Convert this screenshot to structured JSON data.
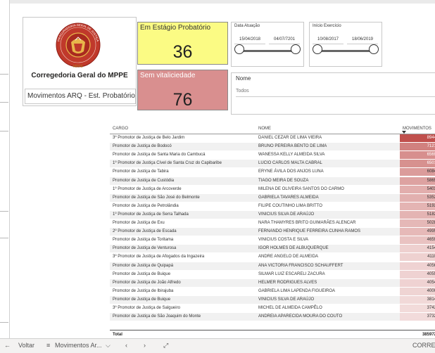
{
  "org": {
    "name": "Corregedoria Geral do MPPE",
    "report_name": "Movimentos ARQ - Est. Probatório"
  },
  "seal": {
    "text": "PROCURADORIA GERAL DE JUSTIÇA",
    "bottom": "MPPE"
  },
  "kpis": {
    "estagio": {
      "label": "Em Estágio Probatório",
      "value": "36",
      "color": "#fbfb84"
    },
    "vitaliciedade": {
      "label": "Sem vitaliciedade",
      "value": "76",
      "color": "#d98f8f"
    }
  },
  "slicers": {
    "data_atuacao": {
      "title": "Data Atuação",
      "start": "15/04/2018",
      "end": "04/07/7201"
    },
    "inicio_exercicio": {
      "title": "Início Exercício",
      "start": "10/08/2017",
      "end": "18/06/2019"
    },
    "nome": {
      "title": "Nome",
      "value": "Todos"
    }
  },
  "table": {
    "headers": {
      "cargo": "CARGO",
      "nome": "NOME",
      "movimentos": "MOVIMENTOS"
    },
    "max_movimentos": 8944,
    "colors": {
      "high": "#c0504d",
      "low": "#f4e1e1"
    },
    "rows": [
      {
        "cargo": "3º Promotor de Justiça de Belo Jardim",
        "nome": "DANIEL CEZAR DE LIMA VIEIRA",
        "movimentos": "8944"
      },
      {
        "cargo": "Promotor de Justiça de Bodocó",
        "nome": "BRUNO PEREIRA BENTO DE LIMA",
        "movimentos": "7121"
      },
      {
        "cargo": "Promotor de Justiça de Santa Maria do Cambucá",
        "nome": "WANESSA KELLY ALMEIDA SILVA",
        "movimentos": "6569"
      },
      {
        "cargo": "1º Promotor de Justiça Cível de Santa Cruz do Capibaribe",
        "nome": "LUCIO CARLOS MALTA CABRAL",
        "movimentos": "6501"
      },
      {
        "cargo": "Promotor de Justiça de Tabira",
        "nome": "ERYNE ÁVILA DOS ANJOS LUNA",
        "movimentos": "6084"
      },
      {
        "cargo": "Promotor de Justiça de Custódia",
        "nome": "TIAGO MEIRA DE SOUZA",
        "movimentos": "5865"
      },
      {
        "cargo": "1º Promotor de Justiça de Arcoverde",
        "nome": "MILENA DE OLIVEIRA SANTOS DO CARMO",
        "movimentos": "5403"
      },
      {
        "cargo": "Promotor de Justiça de São José do Belmonte",
        "nome": "GABRIELA TAVARES ALMEIDA",
        "movimentos": "5352"
      },
      {
        "cargo": "Promotor de Justiça de Petrolândia",
        "nome": "FILIPE COUTINHO LIMA BRITTO",
        "movimentos": "5192"
      },
      {
        "cargo": "1º Promotor de Justiça de Serra Talhada",
        "nome": "VINICIUS SILVA DE ARAÚJO",
        "movimentos": "5182"
      },
      {
        "cargo": "Promotor de Justiça de Exu",
        "nome": "NARA THAMYRES BRITO GUIMARÃES ALENCAR",
        "movimentos": "5028"
      },
      {
        "cargo": "2º Promotor de Justiça de Escada",
        "nome": "FERNANDO HENRIQUE FERREIRA CUNHA RAMOS",
        "movimentos": "4995"
      },
      {
        "cargo": "Promotor de Justiça de Toritama",
        "nome": "VINICIUS COSTA E SILVA",
        "movimentos": "4659"
      },
      {
        "cargo": "Promotor de Justiça de Venturosa",
        "nome": "IGOR HOLMES DE ALBUQUERQUE",
        "movimentos": "4154"
      },
      {
        "cargo": "3º Promotor de Justiça de Afogados da Ingazeira",
        "nome": "ANDRE ANGELO DE ALMEIDA",
        "movimentos": "4110"
      },
      {
        "cargo": "Promotor de Justiça de Quipapá",
        "nome": "ANA VICTORIA FRANCISCO SCHAUFFERT",
        "movimentos": "4056"
      },
      {
        "cargo": "Promotor de Justiça de Buique",
        "nome": "SILMAR LUIZ ESCARELI ZACURA",
        "movimentos": "4055"
      },
      {
        "cargo": "Promotor de Justiça de João Alfredo",
        "nome": "HELMER RODRIGUES ALVES",
        "movimentos": "4054"
      },
      {
        "cargo": "Promotor de Justiça de Ibirajuba",
        "nome": "GABRIELA LIMA LAPENDA FIGUEIROA",
        "movimentos": "4000"
      },
      {
        "cargo": "Promotor de Justiça de Buique",
        "nome": "VINICIUS SILVA DE ARAÚJO",
        "movimentos": "3814"
      },
      {
        "cargo": "3º Promotor de Justiça de Salgueiro",
        "nome": "MICHEL DE ALMEIDA CAMPÊLO",
        "movimentos": "3742"
      },
      {
        "cargo": "Promotor de Justiça de São Joaquim do Monte",
        "nome": "ANDREIA APARECIDA MOURA DO COUTO",
        "movimentos": "3732"
      }
    ],
    "total_label": "Total",
    "total_value": "385972"
  },
  "bottombar": {
    "back": "Voltar",
    "page": "Movimentos Ar...",
    "right": "CORREG"
  }
}
